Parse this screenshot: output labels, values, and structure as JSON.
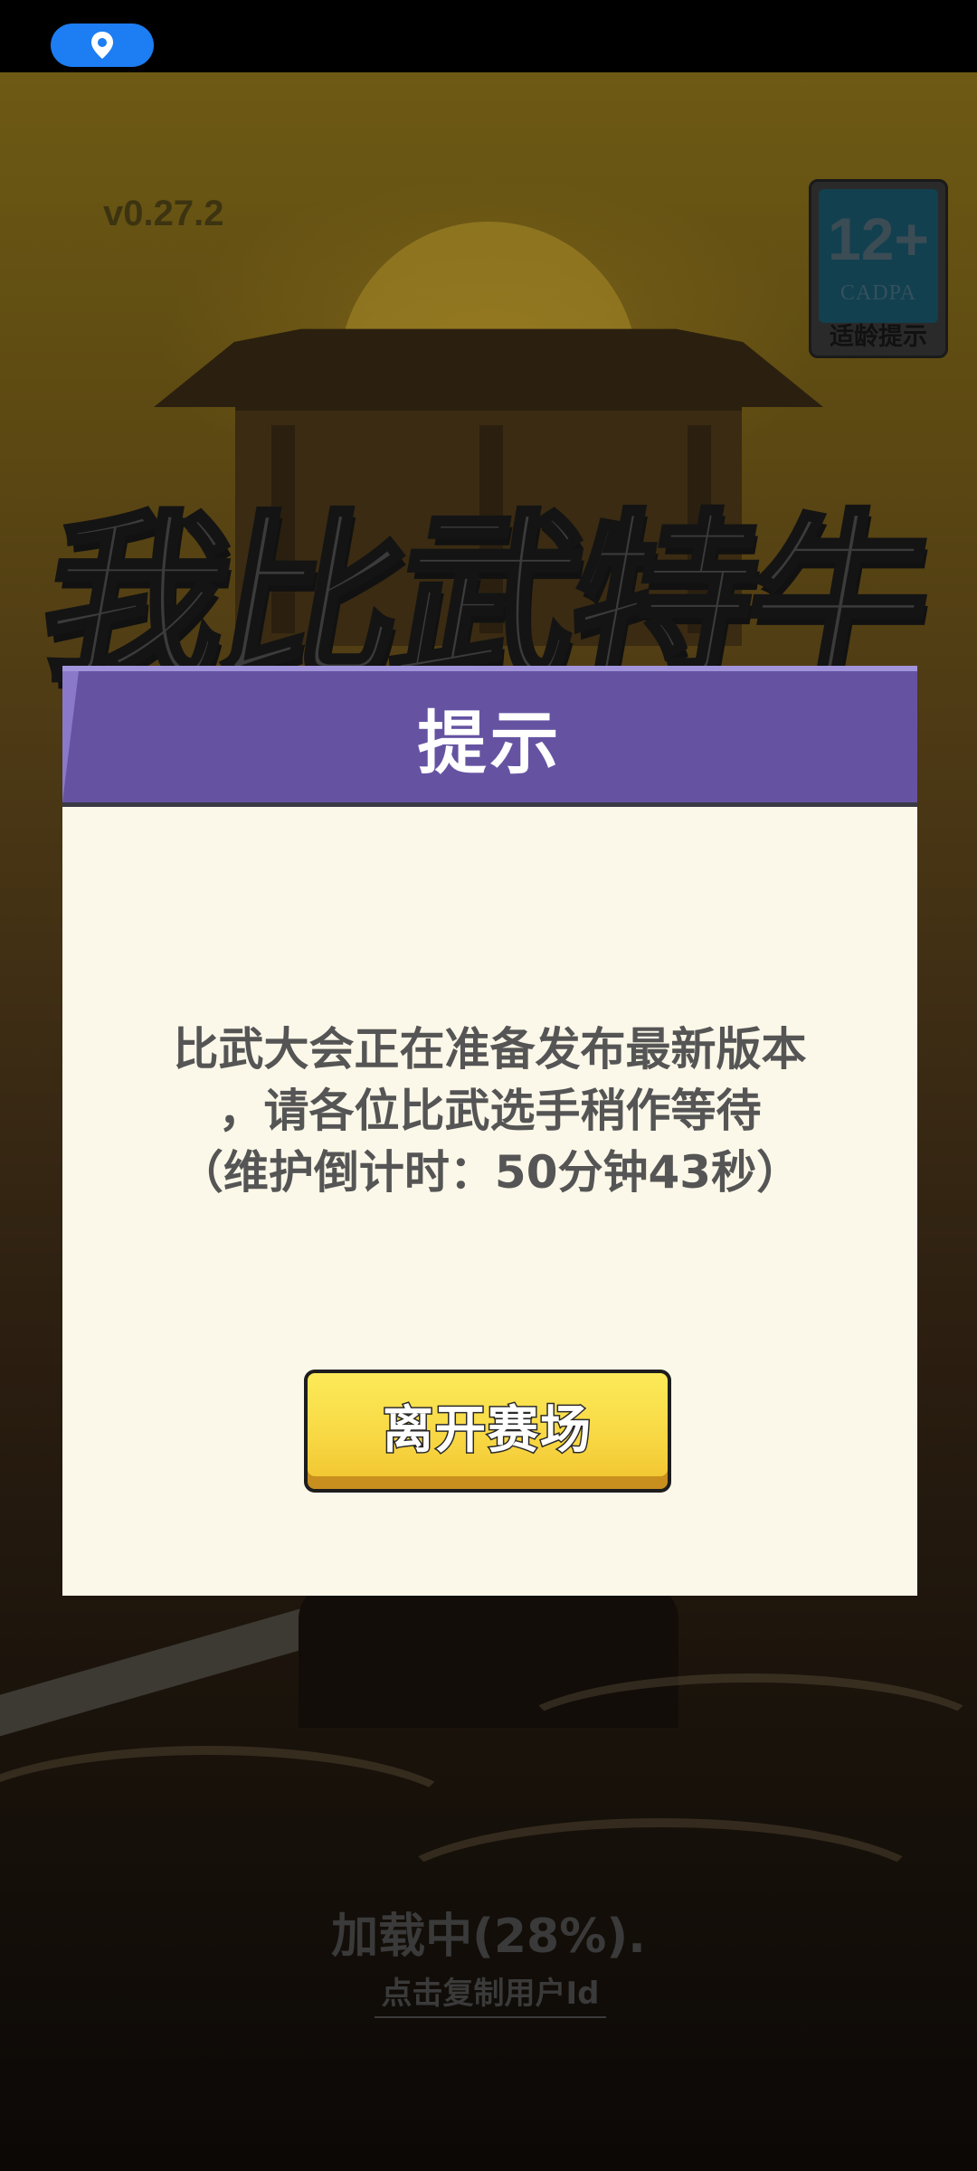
{
  "status_bar": {
    "location_icon": "location-pin-icon",
    "pill_color": "#1d7df2"
  },
  "background": {
    "version": "v0.27.2",
    "game_title": "我比武特牛",
    "age_rating": {
      "number": "12+",
      "org": "CADPA",
      "caption": "适龄提示"
    },
    "loading": {
      "text": "加载中(28%).",
      "percent": 28
    },
    "copy_user_id_link": "点击复制用户Id"
  },
  "dialog": {
    "title": "提示",
    "message_lines": [
      "比武大会正在准备发布最新版本",
      "，请各位比武选手稍作等待",
      "（维护倒计时：50分钟43秒）"
    ],
    "leave_button": "离开赛场",
    "header_color": "#6553a2",
    "body_color": "#fcf8e9",
    "button_color": "#f8d844"
  }
}
